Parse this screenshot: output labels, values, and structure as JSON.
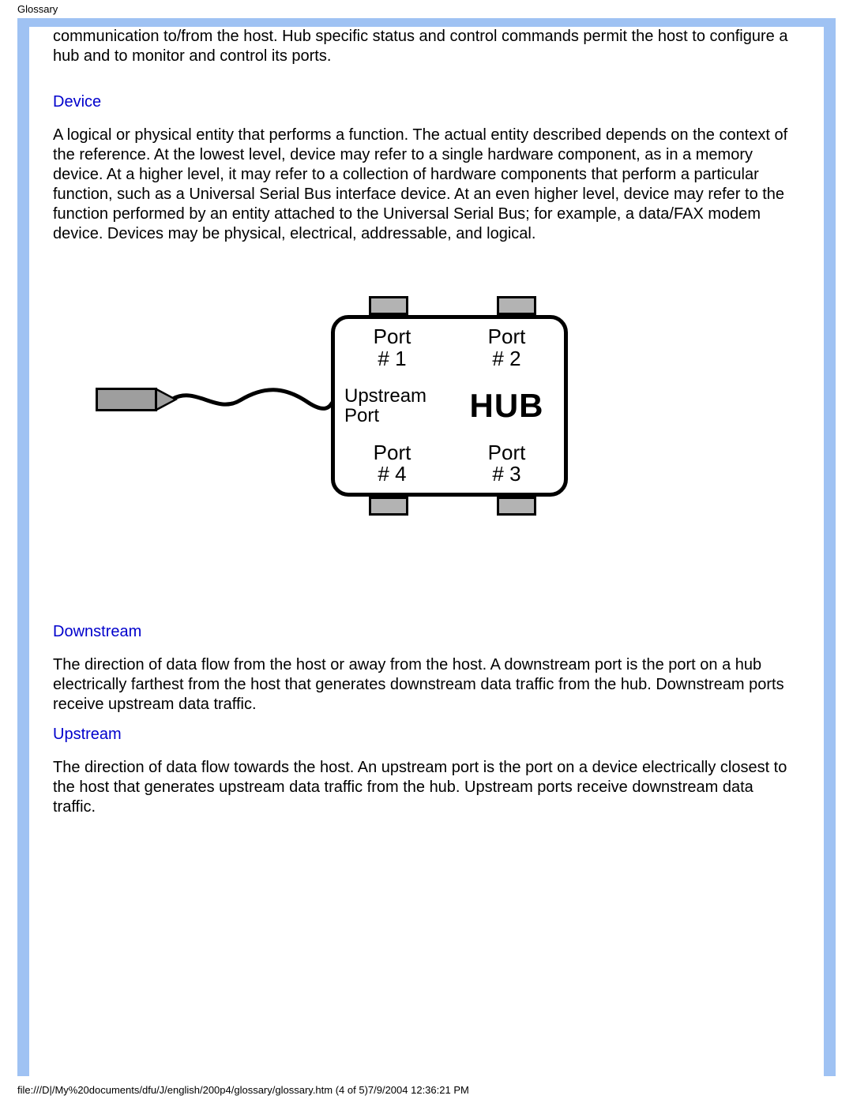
{
  "header_label": "Glossary",
  "para_hub_tail": "communication to/from the host. Hub specific status and control commands permit the host to configure a hub and to monitor and control its ports.",
  "term_device": "Device",
  "para_device": "A logical or physical entity that performs a function. The actual entity described depends on the context of the reference. At the lowest level, device may refer to a single hardware component, as in a memory device. At a higher level, it may refer to a collection of hardware components that perform a particular function, such as a Universal Serial Bus interface device. At an even higher level, device may refer to the function performed by an entity attached to the Universal Serial Bus; for example, a data/FAX modem device. Devices may be physical, electrical, addressable, and logical.",
  "diagram": {
    "port1": "Port\n# 1",
    "port2": "Port\n# 2",
    "upstream": "Upstream\nPort",
    "hub_label": "HUB",
    "port4": "Port\n# 4",
    "port3": "Port\n# 3"
  },
  "term_downstream": "Downstream",
  "para_downstream": "The direction of data flow from the host or away from the host. A downstream port is the port on a hub electrically farthest from the host that generates downstream data traffic from the hub. Downstream ports receive upstream data traffic.",
  "term_upstream": "Upstream",
  "para_upstream": "The direction of data flow towards the host. An upstream port is the port on a device electrically closest to the host that generates upstream data traffic from the hub. Upstream ports receive downstream data traffic.",
  "footer_text": "file:///D|/My%20documents/dfu/J/english/200p4/glossary/glossary.htm (4 of 5)7/9/2004 12:36:21 PM"
}
